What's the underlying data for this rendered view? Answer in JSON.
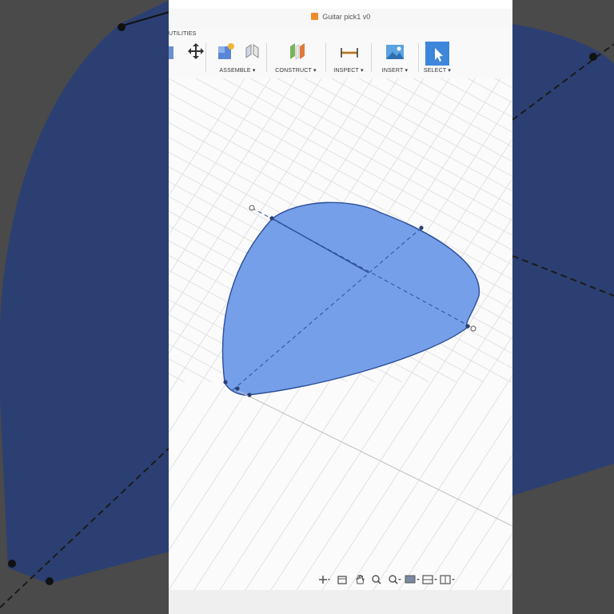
{
  "window": {
    "title": "Guitar pick1 v0"
  },
  "ribbon": {
    "utilities_label": "UTILITIES",
    "groups": [
      {
        "label": "ASSEMBLE ▾"
      },
      {
        "label": "CONSTRUCT ▾"
      },
      {
        "label": "INSPECT ▾"
      },
      {
        "label": "INSERT ▾"
      },
      {
        "label": "SELECT ▾"
      }
    ]
  },
  "colors": {
    "sketch_fill": "#6e9ae8",
    "sketch_stroke": "#2c4f9a",
    "grid": "#dcdcdc",
    "background_dim": "#2c3f72"
  },
  "bottom_toolbar": {
    "icons": [
      "orbit-icon",
      "pan-save-icon",
      "hand-icon",
      "zoom-icon",
      "zoom-window-icon",
      "display-settings-icon",
      "grid-icon",
      "viewports-icon"
    ]
  }
}
